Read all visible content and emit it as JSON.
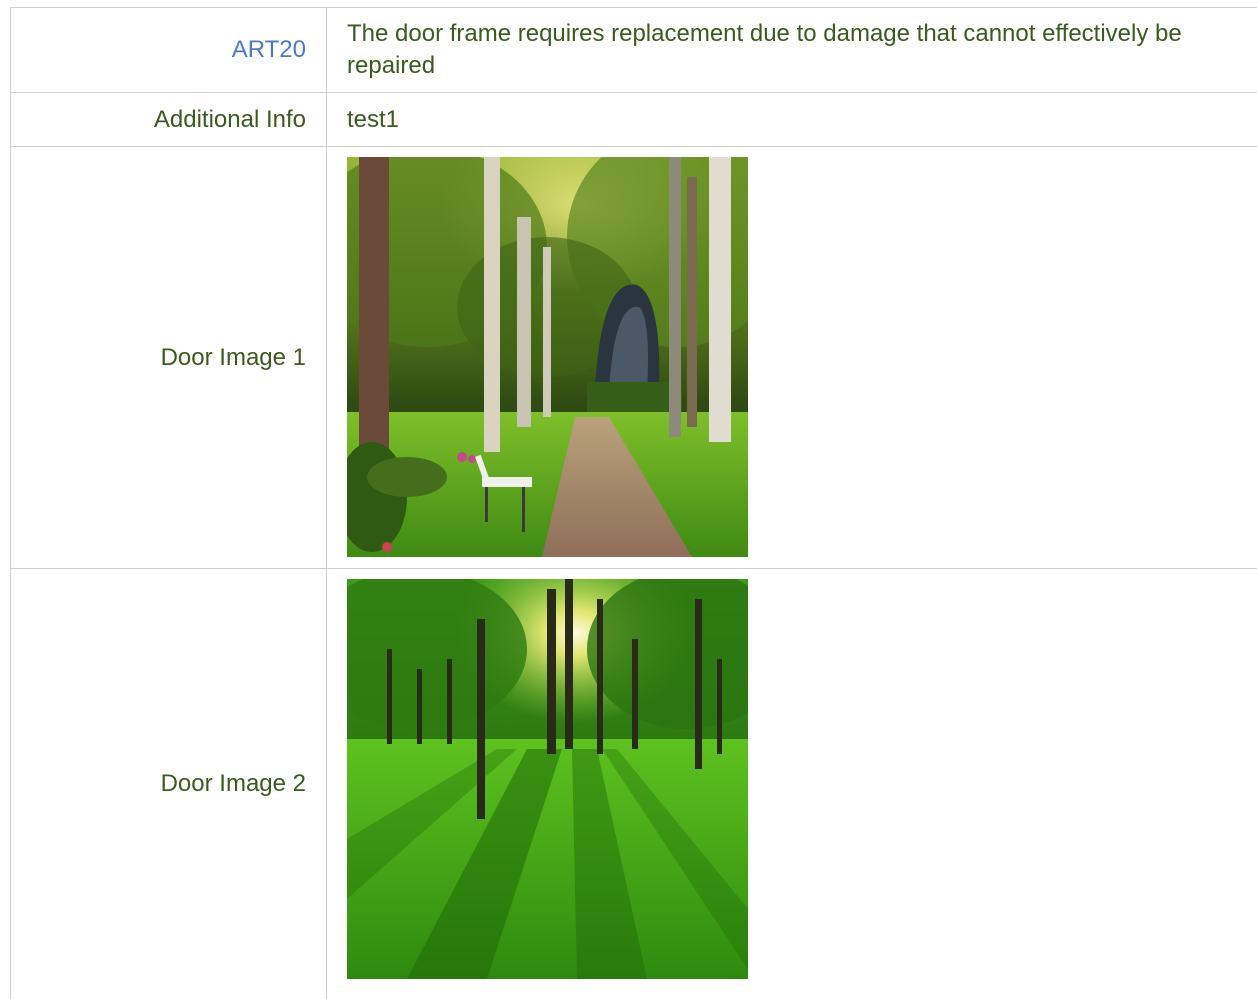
{
  "report": {
    "rows": [
      {
        "label": "ART20",
        "value": "The door frame requires replacement due to damage that cannot effectively be repaired"
      },
      {
        "label": "Additional Info",
        "value": "test1"
      },
      {
        "label": "Door Image 1",
        "image": "park-path-with-bench-photo"
      },
      {
        "label": "Door Image 2",
        "image": "sunlit-green-forest-photo"
      }
    ]
  },
  "colors": {
    "label_text": "#3a5a1e",
    "code_link": "#4a7ac7",
    "border": "#cfcfcf"
  }
}
